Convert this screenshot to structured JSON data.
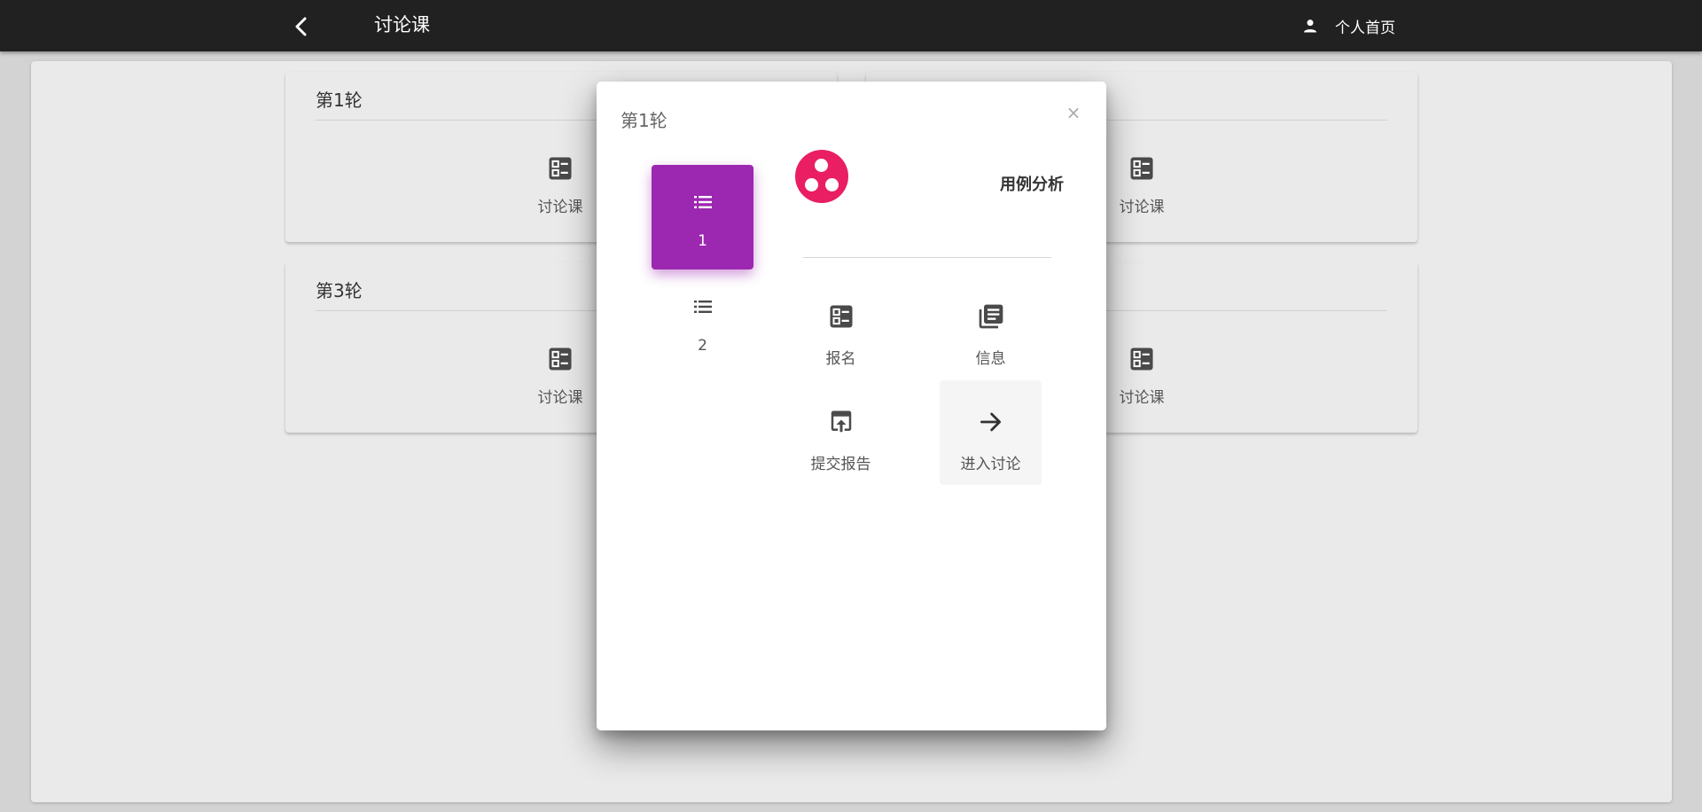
{
  "app": {
    "title": "讨论课",
    "profile_label": "个人首页"
  },
  "rounds": [
    {
      "title": "第1轮",
      "items": [
        {
          "label": "讨论课"
        },
        {
          "label": "讨论课"
        }
      ]
    },
    {
      "title": "",
      "items": [
        {
          "label": "讨论课"
        },
        {
          "label": "讨论课"
        }
      ]
    },
    {
      "title": "第3轮",
      "items": [
        {
          "label": "讨论课"
        },
        {
          "label": "讨论课"
        }
      ]
    },
    {
      "title": "",
      "items": [
        {
          "label": "讨论课"
        },
        {
          "label": "讨论课"
        }
      ]
    }
  ],
  "dialog": {
    "title": "第1轮",
    "close_symbol": "×",
    "groups": [
      {
        "label": "1",
        "active": true
      },
      {
        "label": "2",
        "active": false
      }
    ],
    "topic": {
      "name": "用例分析",
      "avatar_color": "#e91e63"
    },
    "actions": [
      {
        "label": "报名",
        "icon": "list-box-icon"
      },
      {
        "label": "信息",
        "icon": "library-books-icon"
      },
      {
        "label": "提交报告",
        "icon": "upload-box-icon"
      },
      {
        "label": "进入讨论",
        "icon": "arrow-right-icon"
      }
    ]
  },
  "colors": {
    "appbar": "#212121",
    "active_group": "#9c27b0",
    "avatar": "#e91e63"
  }
}
